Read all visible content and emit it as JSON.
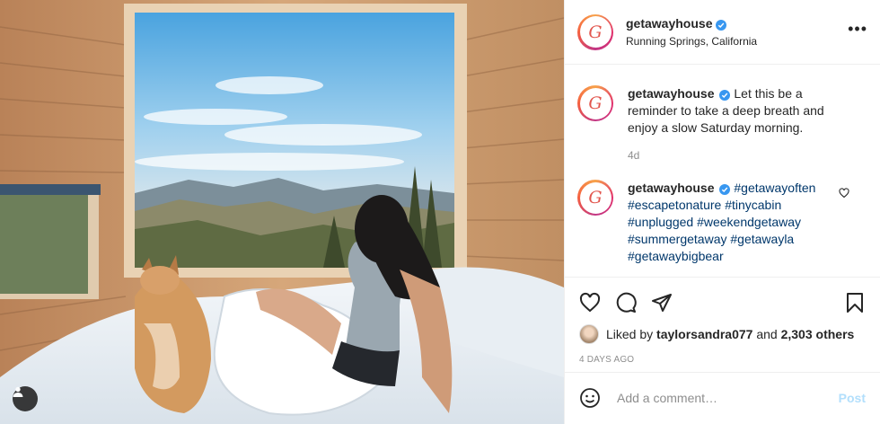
{
  "post": {
    "username": "getawayhouse",
    "location": "Running Springs, California",
    "avatar_letter": "G",
    "more_label": "•••"
  },
  "caption": {
    "username": "getawayhouse",
    "text": "Let this be a reminder to take a deep breath and enjoy a slow Saturday morning.",
    "time": "4d"
  },
  "comment": {
    "username": "getawayhouse",
    "hashtags": [
      "#getawayoften",
      "#escapetonature",
      "#tinycabin",
      "#unplugged",
      "#weekendgetaway",
      "#summergetaway",
      "#getawayla",
      "#getawaybigbear"
    ]
  },
  "likes": {
    "liked_by_prefix": "Liked by",
    "user": "taylorsandra077",
    "conjunction": "and",
    "others": "2,303 others"
  },
  "timestamp": "4 DAYS AGO",
  "add_comment": {
    "placeholder": "Add a comment…",
    "post_label": "Post"
  },
  "colors": {
    "verified": "#3897f0",
    "hashtag": "#00376b",
    "post_button_disabled": "#b2dffc"
  }
}
